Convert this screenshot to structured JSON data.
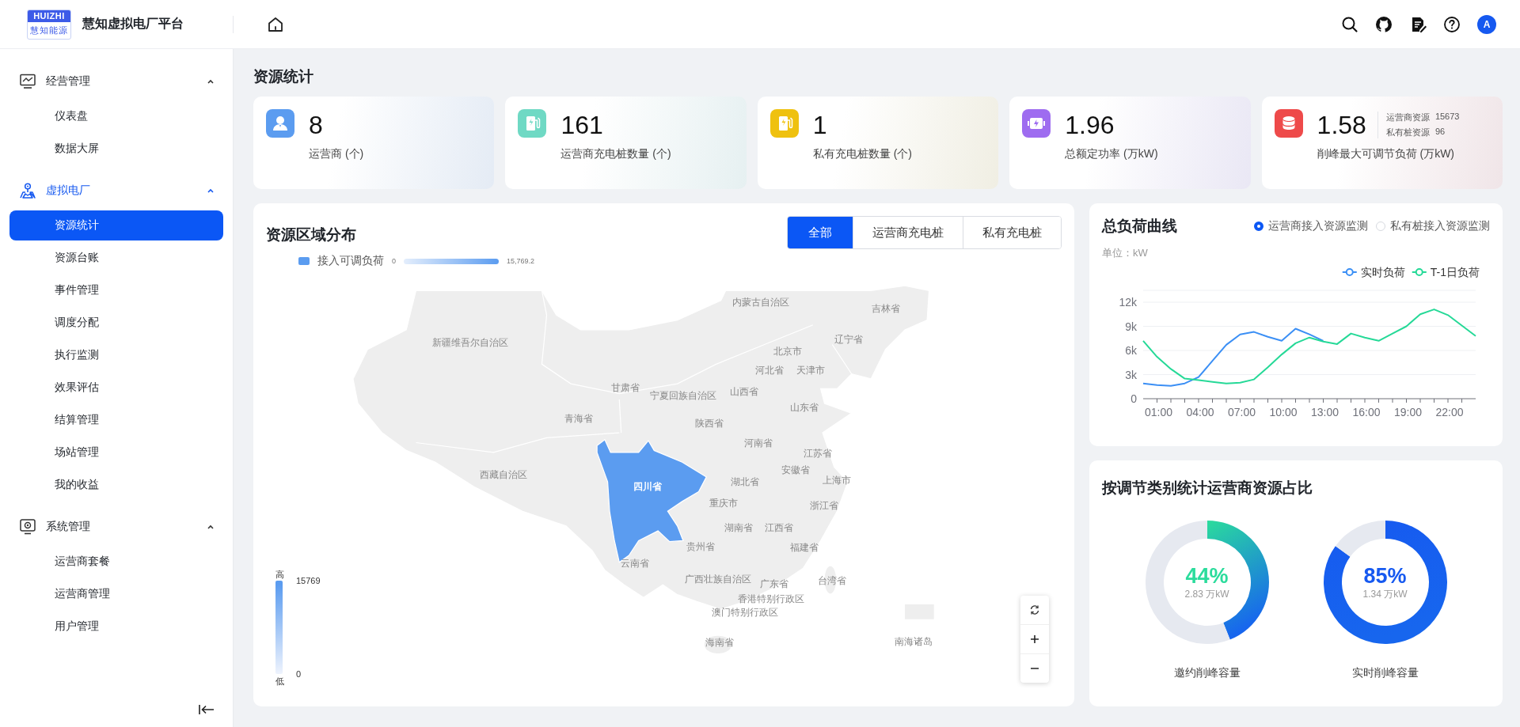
{
  "header": {
    "logo_text": "HUIZHI",
    "logo_subtext": "慧知能源",
    "title": "慧知虚拟电厂平台",
    "avatar": "A"
  },
  "sidebar": {
    "groups": [
      {
        "label": "经营管理",
        "expanded": true,
        "selected": false,
        "children": [
          {
            "label": "仪表盘",
            "selected": false
          },
          {
            "label": "数据大屏",
            "selected": false
          }
        ]
      },
      {
        "label": "虚拟电厂",
        "expanded": true,
        "selected": true,
        "children": [
          {
            "label": "资源统计",
            "selected": true
          },
          {
            "label": "资源台账",
            "selected": false
          },
          {
            "label": "事件管理",
            "selected": false
          },
          {
            "label": "调度分配",
            "selected": false
          },
          {
            "label": "执行监测",
            "selected": false
          },
          {
            "label": "效果评估",
            "selected": false
          },
          {
            "label": "结算管理",
            "selected": false
          },
          {
            "label": "场站管理",
            "selected": false
          },
          {
            "label": "我的收益",
            "selected": false
          }
        ]
      },
      {
        "label": "系统管理",
        "expanded": true,
        "selected": false,
        "children": [
          {
            "label": "运营商套餐",
            "selected": false
          },
          {
            "label": "运营商管理",
            "selected": false
          },
          {
            "label": "用户管理",
            "selected": false
          }
        ]
      }
    ]
  },
  "page_title": "资源统计",
  "stats": [
    {
      "color": "#5b9cf0",
      "value": "8",
      "label": "运营商 (个)"
    },
    {
      "color": "#6fd9c4",
      "value": "161",
      "label": "运营商充电桩数量 (个)"
    },
    {
      "color": "#efc10f",
      "value": "1",
      "label": "私有充电桩数量 (个)"
    },
    {
      "color": "#9e6cf0",
      "value": "1.96",
      "label": "总额定功率 (万kW)"
    },
    {
      "color": "#ee4a4a",
      "value": "1.58",
      "label": "削峰最大可调节负荷 (万kW)",
      "details": [
        {
          "label": "运营商资源",
          "value": "15673"
        },
        {
          "label": "私有桩资源",
          "value": "96"
        }
      ]
    }
  ],
  "region_map": {
    "title": "资源区域分布",
    "tabs": [
      {
        "label": "全部",
        "selected": true
      },
      {
        "label": "运营商充电桩",
        "selected": false
      },
      {
        "label": "私有充电桩",
        "selected": false
      }
    ],
    "legend": {
      "label": "接入可调负荷",
      "min": "0",
      "max": "15,769.2"
    },
    "visual_map": {
      "high": "高",
      "max": "15769",
      "min": "0",
      "low": "低"
    },
    "regions": [
      {
        "name": "内蒙古自治区",
        "highlighted": false
      },
      {
        "name": "吉林省",
        "highlighted": false
      },
      {
        "name": "新疆维吾尔自治区",
        "highlighted": false
      },
      {
        "name": "辽宁省",
        "highlighted": false
      },
      {
        "name": "北京市",
        "highlighted": false
      },
      {
        "name": "河北省",
        "highlighted": false
      },
      {
        "name": "天津市",
        "highlighted": false
      },
      {
        "name": "甘肃省",
        "highlighted": false
      },
      {
        "name": "宁夏回族自治区",
        "highlighted": false
      },
      {
        "name": "山西省",
        "highlighted": false
      },
      {
        "name": "山东省",
        "highlighted": false
      },
      {
        "name": "青海省",
        "highlighted": false
      },
      {
        "name": "陕西省",
        "highlighted": false
      },
      {
        "name": "河南省",
        "highlighted": false
      },
      {
        "name": "江苏省",
        "highlighted": false
      },
      {
        "name": "安徽省",
        "highlighted": false
      },
      {
        "name": "西藏自治区",
        "highlighted": false
      },
      {
        "name": "湖北省",
        "highlighted": false
      },
      {
        "name": "上海市",
        "highlighted": false
      },
      {
        "name": "四川省",
        "highlighted": true
      },
      {
        "name": "重庆市",
        "highlighted": false
      },
      {
        "name": "浙江省",
        "highlighted": false
      },
      {
        "name": "湖南省",
        "highlighted": false
      },
      {
        "name": "江西省",
        "highlighted": false
      },
      {
        "name": "贵州省",
        "highlighted": false
      },
      {
        "name": "福建省",
        "highlighted": false
      },
      {
        "name": "云南省",
        "highlighted": false
      },
      {
        "name": "广西壮族自治区",
        "highlighted": false
      },
      {
        "name": "广东省",
        "highlighted": false
      },
      {
        "name": "台湾省",
        "highlighted": false
      },
      {
        "name": "香港特别行政区",
        "highlighted": false
      },
      {
        "name": "澳门特别行政区",
        "highlighted": false
      },
      {
        "name": "海南省",
        "highlighted": false
      },
      {
        "name": "南海诸岛",
        "highlighted": false
      }
    ]
  },
  "load_curve": {
    "title": "总负荷曲线",
    "options": [
      {
        "label": "运营商接入资源监测",
        "selected": true
      },
      {
        "label": "私有桩接入资源监测",
        "selected": false
      }
    ],
    "unit": "单位：kW",
    "chart_data": {
      "type": "line",
      "x": [
        0,
        1,
        2,
        3,
        4,
        5,
        6,
        7,
        8,
        9,
        10,
        11,
        12,
        13,
        14,
        15,
        16,
        17,
        18,
        19,
        20,
        21,
        22,
        23,
        24
      ],
      "xlim": [
        0,
        24
      ],
      "xticks": [
        {
          "value": 1,
          "label": "01:00"
        },
        {
          "value": 4,
          "label": "04:00"
        },
        {
          "value": 7,
          "label": "07:00"
        },
        {
          "value": 10,
          "label": "10:00"
        },
        {
          "value": 13,
          "label": "13:00"
        },
        {
          "value": 16,
          "label": "16:00"
        },
        {
          "value": 19,
          "label": "19:00"
        },
        {
          "value": 22,
          "label": "22:00"
        }
      ],
      "grid": true,
      "legend": "top-right",
      "yticks": [
        {
          "value": 0,
          "label": "0"
        },
        {
          "value": 3000,
          "label": "3k"
        },
        {
          "value": 6000,
          "label": "6k"
        },
        {
          "value": 9000,
          "label": "9k"
        },
        {
          "value": 12000,
          "label": "12k"
        }
      ],
      "ylim": [
        0,
        12000
      ],
      "series": [
        {
          "name": "实时负荷",
          "color": "#3b8ff5",
          "values": [
            1900,
            1700,
            1600,
            1900,
            2700,
            4700,
            6700,
            8000,
            8300,
            7700,
            7200,
            8700,
            8000,
            7200,
            null,
            null,
            null,
            null,
            null,
            null,
            null,
            null,
            null,
            null,
            null
          ]
        },
        {
          "name": "T-1日负荷",
          "color": "#25d997",
          "values": [
            7200,
            5200,
            3700,
            2500,
            2300,
            2100,
            1900,
            2000,
            2400,
            3900,
            5500,
            6900,
            7600,
            7100,
            6800,
            8100,
            7600,
            7200,
            8100,
            9000,
            10500,
            11100,
            10400,
            9100,
            7800
          ]
        }
      ]
    }
  },
  "ratio": {
    "title": "按调节类别统计运营商资源占比",
    "gauges": [
      {
        "percent": "44%",
        "amount": "2.83 万kW",
        "label": "邀约削峰容量",
        "chart_data": {
          "type": "donut",
          "values": [
            44,
            56
          ]
        },
        "color": "#2bdc9c"
      },
      {
        "percent": "85%",
        "amount": "1.34 万kW",
        "label": "实时削峰容量",
        "chart_data": {
          "type": "donut",
          "values": [
            85,
            15
          ]
        },
        "color": "#1659f0"
      }
    ]
  }
}
